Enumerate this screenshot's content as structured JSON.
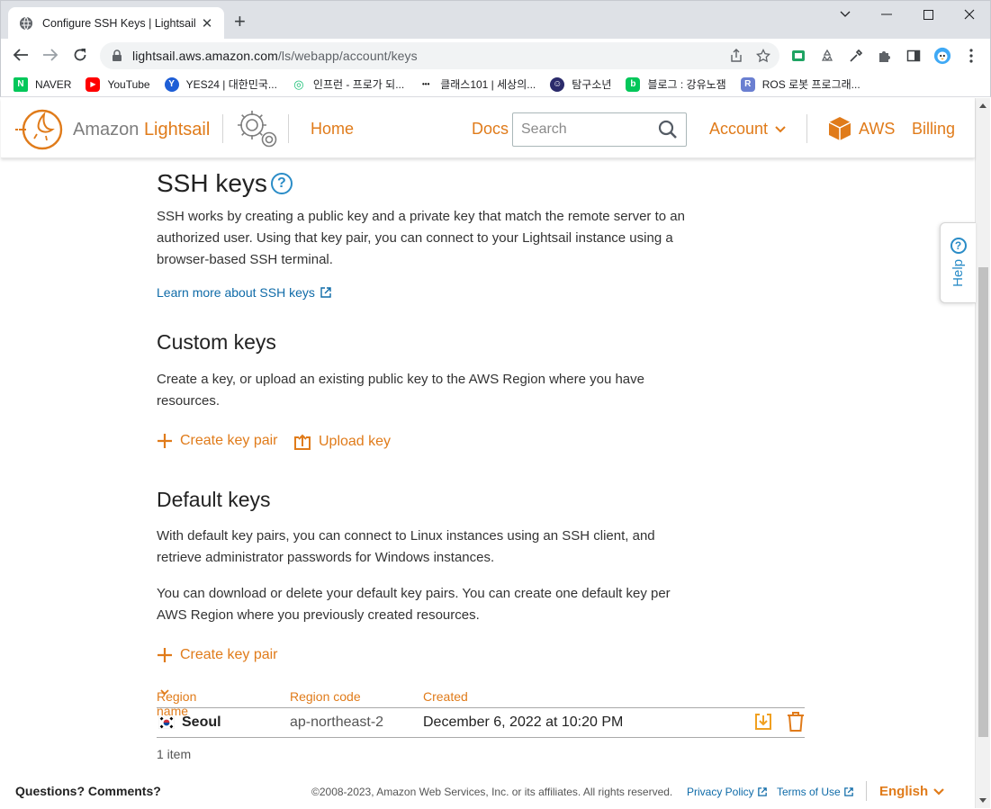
{
  "browser": {
    "tab_title": "Configure SSH Keys | Lightsail",
    "url_host": "lightsail.aws.amazon.com",
    "url_path": "/ls/webapp/account/keys",
    "bookmarks": [
      {
        "label": "NAVER",
        "color": "#03c75a",
        "glyph": "N"
      },
      {
        "label": "YouTube",
        "color": "#ff0000",
        "glyph": "▶"
      },
      {
        "label": "YES24 | 대한민국...",
        "color": "#1e5ed6",
        "glyph": "Y"
      },
      {
        "label": "인프런 - 프로가 되...",
        "color": "#1dc078",
        "glyph": "◎"
      },
      {
        "label": "클래스101 | 세상의...",
        "color": "#111111",
        "glyph": "•••"
      },
      {
        "label": "탐구소년",
        "color": "#2b2b6b",
        "glyph": "☺"
      },
      {
        "label": "블로그 : 강유노잼",
        "color": "#03c75a",
        "glyph": "b"
      },
      {
        "label": "ROS 로봇 프로그래...",
        "color": "#6a7fd1",
        "glyph": "R"
      }
    ]
  },
  "header": {
    "logo_prefix": "Amazon ",
    "logo_brand": "Lightsail",
    "home": "Home",
    "docs": "Docs",
    "search_placeholder": "Search",
    "account": "Account",
    "aws": "AWS",
    "billing": "Billing"
  },
  "page": {
    "title": "SSH keys",
    "intro": "SSH works by creating a public key and a private key that match the remote server to an authorized user. Using that key pair, you can connect to your Lightsail instance using a browser-based SSH terminal.",
    "learn_more": "Learn more about SSH keys",
    "custom": {
      "title": "Custom keys",
      "desc": "Create a key, or upload an existing public key to the AWS Region where you have resources.",
      "create": "Create key pair",
      "upload": "Upload key"
    },
    "default": {
      "title": "Default keys",
      "desc1": "With default key pairs, you can connect to Linux instances using an SSH client, and retrieve administrator passwords for Windows instances.",
      "desc2": "You can download or delete your default key pairs. You can create one default key per AWS Region where you previously created resources.",
      "create": "Create key pair"
    },
    "table": {
      "col_region_name": "Region name",
      "col_region_code": "Region code",
      "col_created": "Created",
      "rows": [
        {
          "region_name": "Seoul",
          "region_code": "ap-northeast-2",
          "created": "December 6, 2022 at 10:20 PM"
        }
      ],
      "count": "1 item"
    }
  },
  "footer": {
    "questions": "Questions? Comments?",
    "copyright": "©2008-2023, Amazon Web Services, Inc. or its affiliates. All rights reserved.",
    "privacy": "Privacy Policy",
    "terms": "Terms of Use",
    "language": "English"
  },
  "help_tab": "Help",
  "colors": {
    "accent": "#e07b1a",
    "link": "#0f6ba8",
    "help": "#2a8cc7"
  }
}
